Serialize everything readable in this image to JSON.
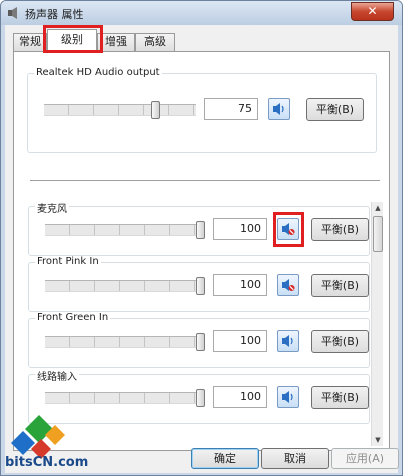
{
  "window": {
    "title": "扬声器 属性",
    "close_label": "✕"
  },
  "tabs": [
    {
      "label": "常规",
      "active": false
    },
    {
      "label": "级别",
      "active": true
    },
    {
      "label": "增强",
      "active": false
    },
    {
      "label": "高级",
      "active": false
    }
  ],
  "main_device": {
    "label": "Realtek HD Audio output",
    "level": 75,
    "level_text": "75",
    "muted": false,
    "balance_label": "平衡(B)"
  },
  "inputs": [
    {
      "label": "麦克风",
      "level": 100,
      "level_text": "100",
      "muted": true,
      "balance_label": "平衡(B)",
      "highlighted": true
    },
    {
      "label": "Front Pink In",
      "level": 100,
      "level_text": "100",
      "muted": true,
      "balance_label": "平衡(B)",
      "highlighted": false
    },
    {
      "label": "Front Green In",
      "level": 100,
      "level_text": "100",
      "muted": false,
      "balance_label": "平衡(B)",
      "highlighted": false
    },
    {
      "label": "线路输入",
      "level": 100,
      "level_text": "100",
      "muted": false,
      "balance_label": "平衡(B)",
      "highlighted": false
    }
  ],
  "footer": {
    "ok_label": "确定",
    "cancel_label": "取消",
    "apply_label": "应用(A)"
  },
  "watermark": {
    "text": "bitsCN.com"
  },
  "colors": {
    "highlight": "#e02020",
    "window_frame": "#c9d7e8",
    "accent_blue": "#2a6fc2",
    "mute_red": "#d62b2b"
  },
  "icons": {
    "speaker": "speaker-icon",
    "speaker_muted": "speaker-muted-icon",
    "window": "speaker-window-icon",
    "scroll_up": "scroll-up-arrow",
    "scroll_down": "scroll-down-arrow"
  }
}
